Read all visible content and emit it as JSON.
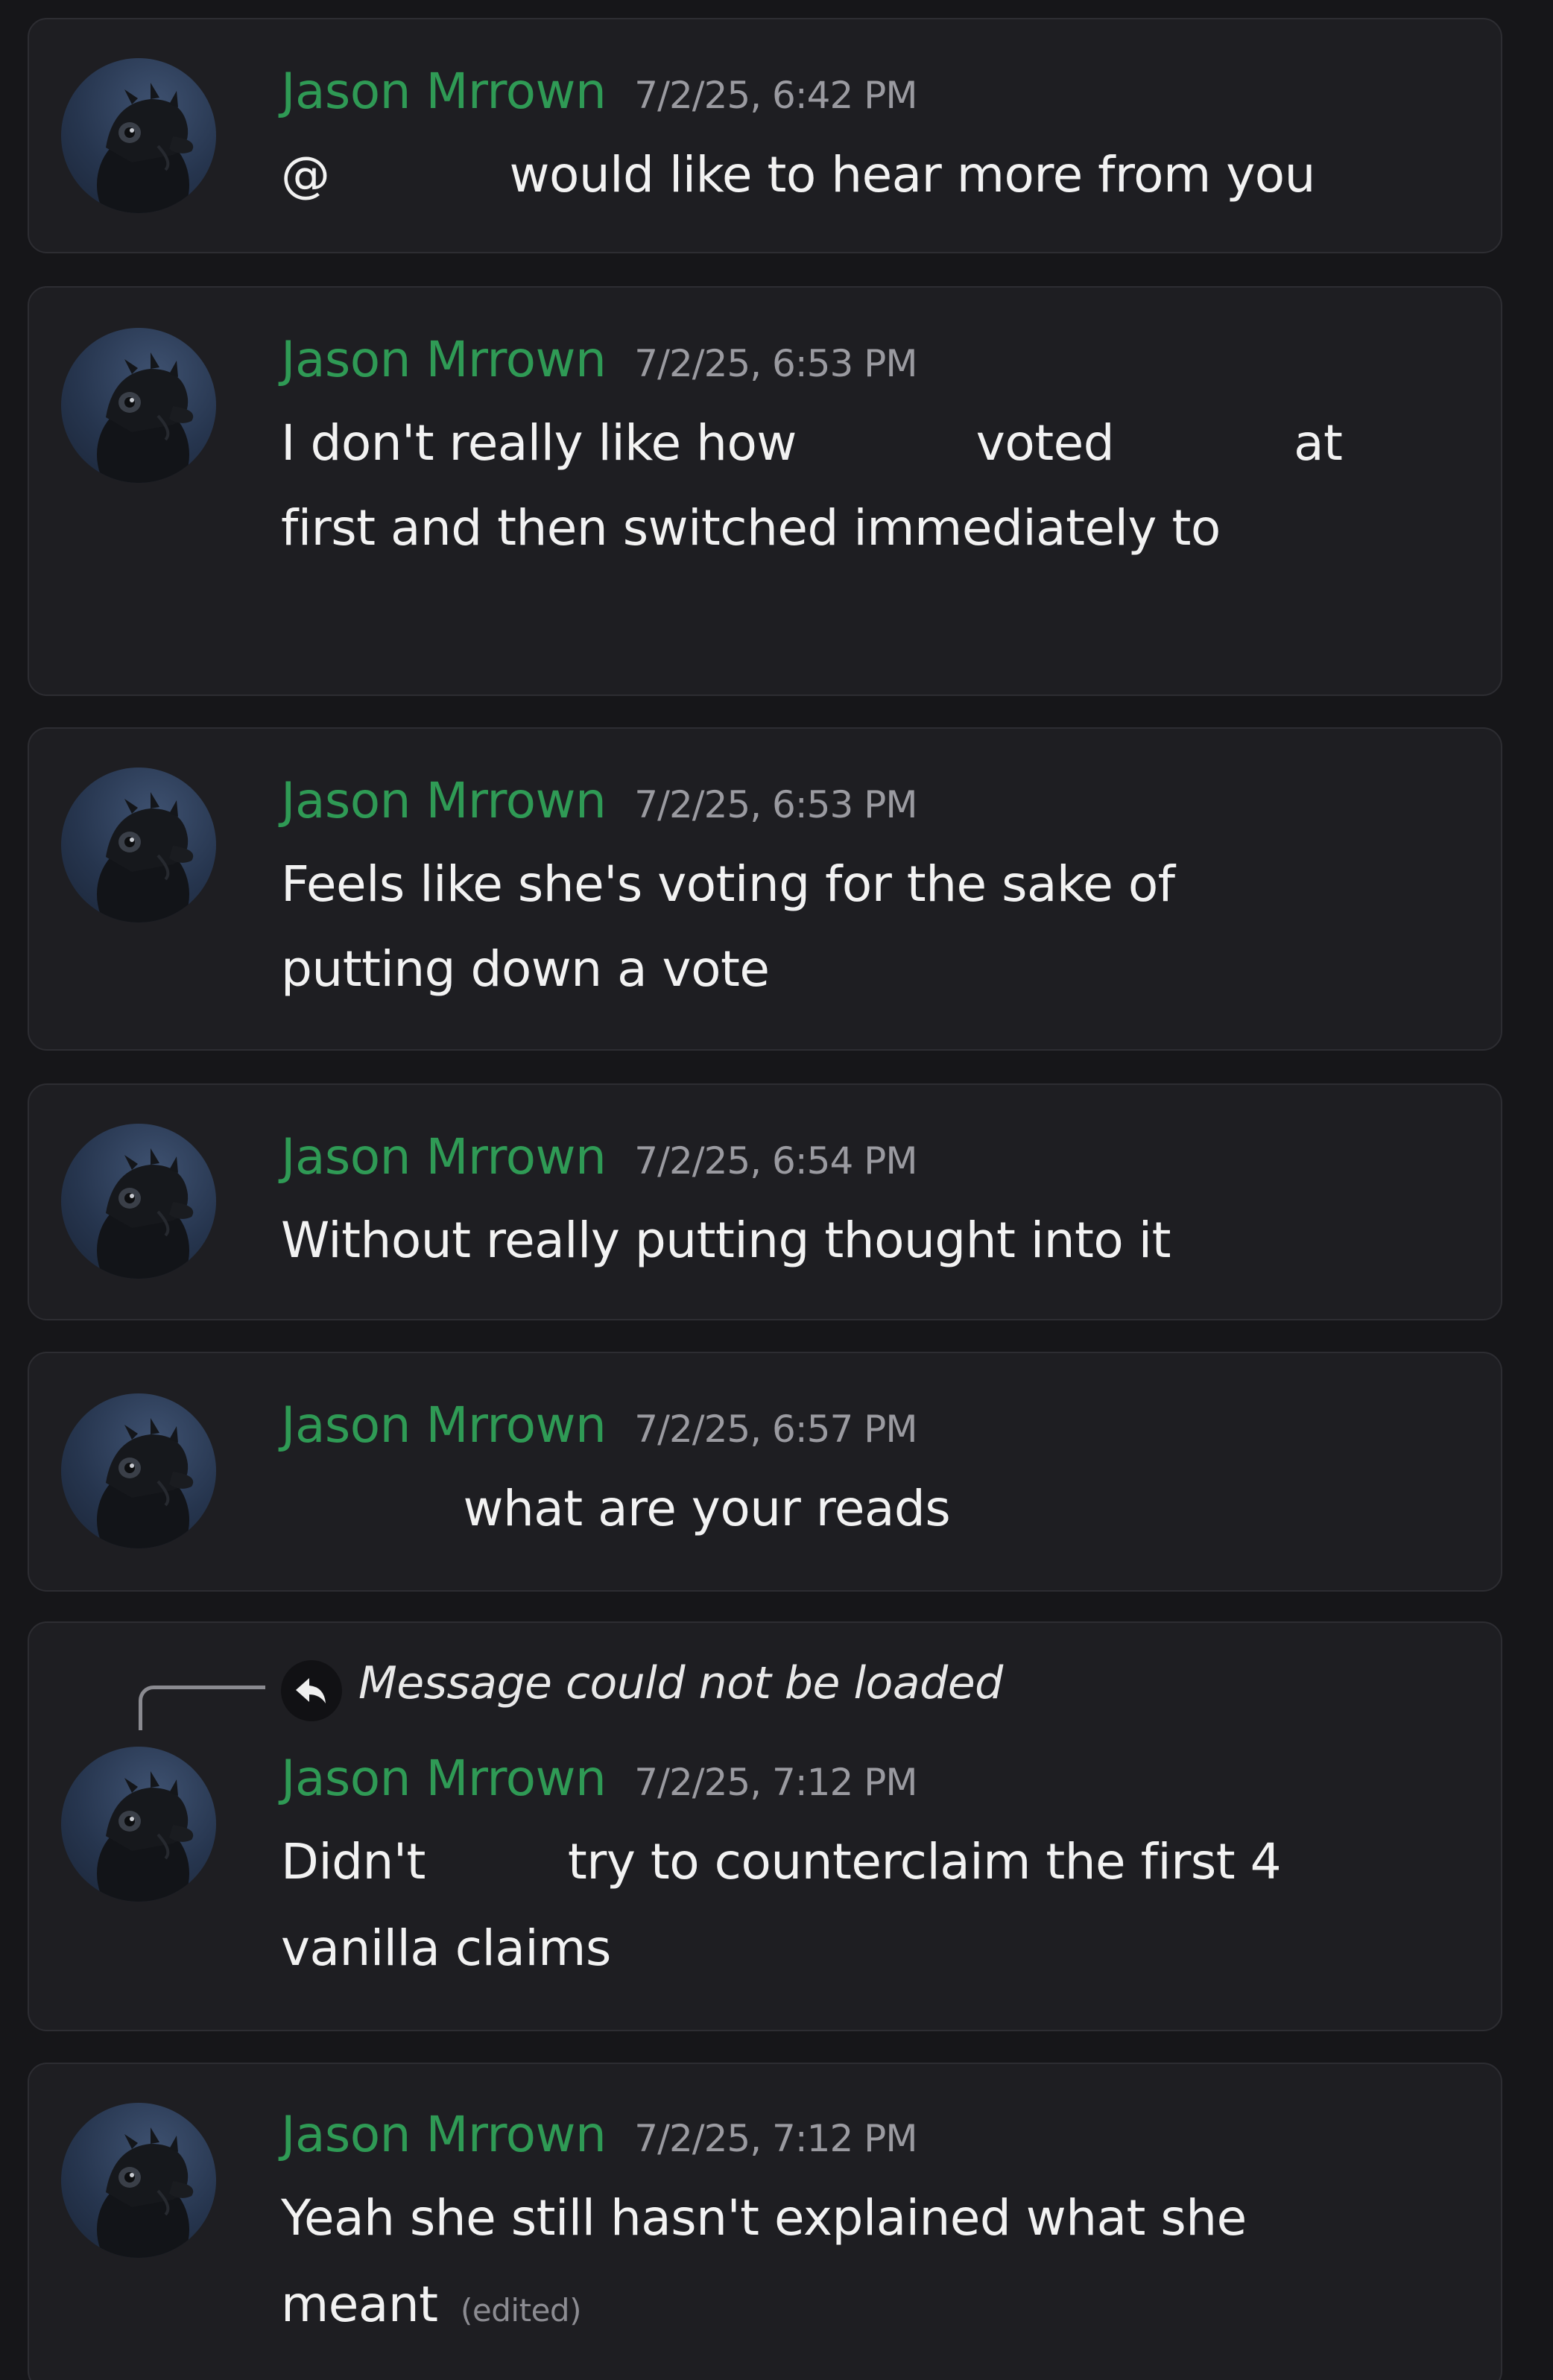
{
  "messages": [
    {
      "author": "Jason Mrrown",
      "timestamp": "7/2/25, 6:42 PM",
      "lines": [
        {
          "a": "@",
          "b": "would like to hear more from you",
          "c": ""
        }
      ]
    },
    {
      "author": "Jason Mrrown",
      "timestamp": "7/2/25, 6:53 PM",
      "lines": [
        {
          "a": "I don't really like how",
          "b": "voted",
          "c": "at"
        },
        {
          "a": "first and then switched immediately to",
          "b": "",
          "c": ""
        }
      ]
    },
    {
      "author": "Jason Mrrown",
      "timestamp": "7/2/25, 6:53 PM",
      "lines": [
        {
          "a": "Feels like she's voting for the sake of",
          "b": "",
          "c": ""
        },
        {
          "a": "putting down a vote",
          "b": "",
          "c": ""
        }
      ]
    },
    {
      "author": "Jason Mrrown",
      "timestamp": "7/2/25, 6:54 PM",
      "lines": [
        {
          "a": "Without really putting thought into it",
          "b": "",
          "c": ""
        }
      ]
    },
    {
      "author": "Jason Mrrown",
      "timestamp": "7/2/25, 6:57 PM",
      "lines": [
        {
          "a": "",
          "b": "what are your reads",
          "c": ""
        }
      ]
    },
    {
      "author": "Jason Mrrown",
      "timestamp": "7/2/25, 7:12 PM",
      "reply": "Message could not be loaded",
      "lines": [
        {
          "a": "Didn't",
          "b": "try to counterclaim the first 4",
          "c": ""
        },
        {
          "a": "vanilla claims",
          "b": "",
          "c": ""
        }
      ]
    },
    {
      "author": "Jason Mrrown",
      "timestamp": "7/2/25, 7:12 PM",
      "edited": "(edited)",
      "lines": [
        {
          "a": "Yeah she still hasn't explained what she",
          "b": "",
          "c": ""
        },
        {
          "a": "meant",
          "b": "",
          "c": ""
        }
      ]
    }
  ],
  "colors": {
    "background": "#161619",
    "card": "#1e1e22",
    "author": "#2f9a55",
    "timestamp": "#9a9aa0",
    "text": "#f2f2f2"
  },
  "icons": {
    "avatar": "dragon-avatar-icon",
    "reply": "reply-arrow-icon"
  }
}
